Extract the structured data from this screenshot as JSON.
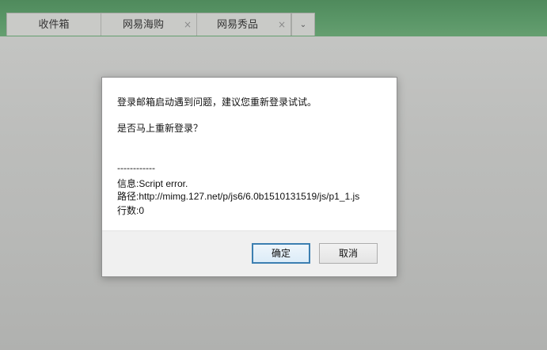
{
  "tabs": [
    {
      "label": "收件箱",
      "closable": false
    },
    {
      "label": "网易海购",
      "close_glyph": "×"
    },
    {
      "label": "网易秀品",
      "close_glyph": "×"
    }
  ],
  "tab_more_glyph": "⌄",
  "dialog": {
    "message": "登录邮箱启动遇到问题，建议您重新登录试试。",
    "question": "是否马上重新登录？",
    "separator": "------------",
    "info": "信息:Script error.",
    "path": "路径:http://mimg.127.net/p/js6/6.0b1510131519/js/p1_1.js",
    "line": "行数:0",
    "ok_label": "确定",
    "cancel_label": "取消"
  },
  "colors": {
    "header_green": "#5a9667",
    "backdrop_gray": "#bcbdbb",
    "ok_border_blue": "#3c7fb1"
  }
}
